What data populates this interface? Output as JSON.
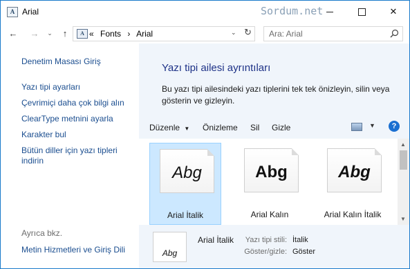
{
  "window": {
    "title": "Arial",
    "watermark": "Sordum.net",
    "app_icon_glyph": "A",
    "close_glyph": "✕"
  },
  "address_bar": {
    "back_glyph": "←",
    "forward_glyph": "→",
    "recent_glyph": "⌄",
    "up_glyph": "↑",
    "location_icon_glyph": "A",
    "overflow_glyph": "«",
    "crumbs": [
      "Fonts",
      "Arial"
    ],
    "crumb_separator": "›",
    "dropdown_glyph": "⌄",
    "refresh_glyph": "↻",
    "search_placeholder": "Ara: Arial"
  },
  "left_pane": {
    "home_link": "Denetim Masası Giriş",
    "links": [
      "Yazı tipi ayarları",
      "Çevrimiçi daha çok bilgi alın",
      "ClearType metnini ayarla",
      "Karakter bul",
      "Bütün diller için yazı tipleri",
      "indirin"
    ],
    "see_also_heading": "Ayrıca bkz.",
    "see_also_link": "Metin Hizmetleri ve Giriş Dili"
  },
  "main": {
    "title": "Yazı tipi ailesi ayrıntıları",
    "description_line1": "Bu yazı tipi ailesindeki yazı tiplerini tek tek önizleyin, silin veya",
    "description_line2": "gösterin ve gizleyin."
  },
  "toolbar": {
    "organize": "Düzenle",
    "organize_arrow": "▼",
    "preview": "Önizleme",
    "delete": "Sil",
    "hide": "Gizle",
    "view_arrow": "▼",
    "help": "?"
  },
  "fonts": [
    {
      "label": "Arial İtalik",
      "preview": "Abg",
      "style": "italic",
      "weight": "normal",
      "selected": true
    },
    {
      "label": "Arial Kalın",
      "preview": "Abg",
      "style": "normal",
      "weight": "bold",
      "selected": false
    },
    {
      "label": "Arial Kalın İtalik",
      "preview": "Abg",
      "style": "italic",
      "weight": "bold",
      "selected": false
    }
  ],
  "scrollbar": {
    "up_glyph": "▲",
    "down_glyph": "▼"
  },
  "details": {
    "preview": "Abg",
    "name": "Arial İtalik",
    "style_key": "Yazı tipi stili:",
    "style_value": "İtalik",
    "visibility_key": "Göster/gizle:",
    "visibility_value": "Göster"
  }
}
